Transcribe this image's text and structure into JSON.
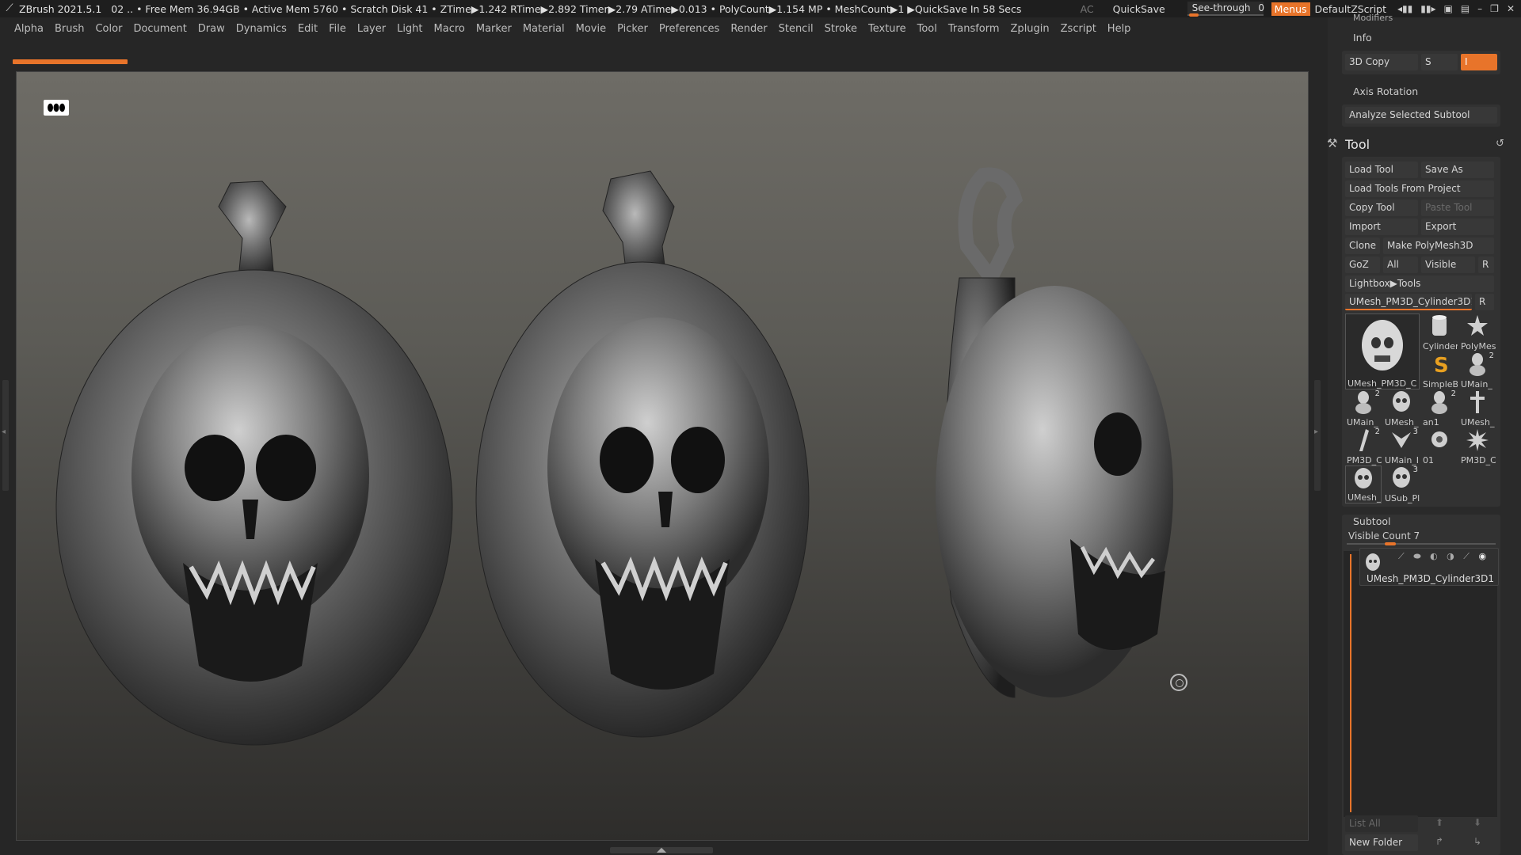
{
  "titlebar": {
    "app_title": "ZBrush 2021.5.1",
    "stats": "02  .. • Free Mem 36.94GB • Active Mem 5760 • Scratch Disk 41 •  ZTime▶1.242 RTime▶2.892 Timer▶2.79 ATime▶0.013 • PolyCount▶1.154 MP  • MeshCount▶1  ▶QuickSave In 58 Secs",
    "ac": "AC",
    "quicksave": "QuickSave",
    "seethrough_label": "See-through",
    "seethrough_value": "0",
    "seethrough_level": 0,
    "menus": "Menus",
    "default_zscript": "DefaultZScript"
  },
  "menubar": {
    "items": [
      "Alpha",
      "Brush",
      "Color",
      "Document",
      "Draw",
      "Dynamics",
      "Edit",
      "File",
      "Layer",
      "Light",
      "Macro",
      "Marker",
      "Material",
      "Movie",
      "Picker",
      "Preferences",
      "Render",
      "Stencil",
      "Stroke",
      "Texture",
      "Tool",
      "Transform",
      "Zplugin",
      "Zscript",
      "Help"
    ]
  },
  "viewport": {
    "badge": "⬮⬮⬮",
    "models": [
      "skull-pendant-front",
      "skull-pendant-three-quarter",
      "skull-pendant-side"
    ]
  },
  "right_panel": {
    "modifiers_label": "Modifiers",
    "info_label": "Info",
    "copy3d_label": "3D Copy",
    "s_label": "S",
    "i_label": "I",
    "axis_rotation_label": "Axis Rotation",
    "analyze_label": "Analyze Selected Subtool",
    "tool_title": "Tool",
    "buttons": {
      "load_tool": "Load Tool",
      "save_as": "Save As",
      "load_tools_from_project": "Load Tools From Project",
      "copy_tool": "Copy Tool",
      "paste_tool": "Paste Tool",
      "import": "Import",
      "export": "Export",
      "clone": "Clone",
      "make_polymesh": "Make PolyMesh3D",
      "goz": "GoZ",
      "all": "All",
      "visible": "Visible",
      "r": "R",
      "lightbox_tools": "Lightbox▶Tools",
      "current_tool": "UMesh_PM3D_Cylinder3D1",
      "current_r": "R"
    },
    "thumbs": [
      {
        "label": "UMesh_PM3D_C",
        "count": ""
      },
      {
        "label": "Cylinder",
        "count": ""
      },
      {
        "label": "PolyMes",
        "count": ""
      },
      {
        "label": "SimpleB",
        "count": ""
      },
      {
        "label": "UMain_",
        "count": "2"
      },
      {
        "label": "UMain_",
        "count": "2"
      },
      {
        "label": "UMesh_",
        "count": ""
      },
      {
        "label": "an1",
        "count": "2"
      },
      {
        "label": "UMesh_",
        "count": ""
      },
      {
        "label": "PM3D_C",
        "count": "2"
      },
      {
        "label": "UMain_I",
        "count": "3"
      },
      {
        "label": "01",
        "count": ""
      },
      {
        "label": "PM3D_C",
        "count": ""
      },
      {
        "label": "UMesh_",
        "count": ""
      },
      {
        "label": "USub_Pl",
        "count": "3"
      }
    ],
    "subtool": {
      "title": "Subtool",
      "visible_count": "Visible Count 7",
      "item_name": "UMesh_PM3D_Cylinder3D1",
      "list_all": "List All",
      "new_folder": "New Folder"
    }
  }
}
